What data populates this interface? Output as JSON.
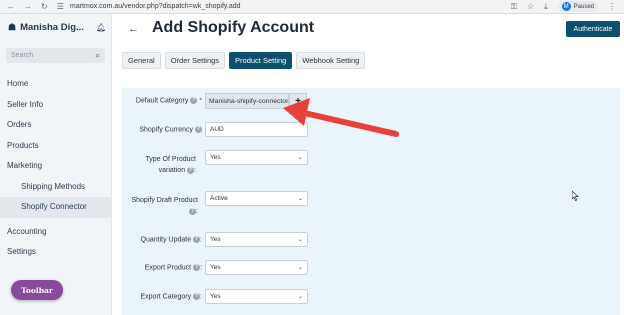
{
  "browser": {
    "url": "martmox.com.au/vendor.php?dispatch=wk_shopify.add",
    "profile_initial": "M",
    "profile_status": "Paused"
  },
  "sidebar": {
    "brand": "Manisha Dig...",
    "search_placeholder": "Search",
    "items": [
      {
        "label": "Home"
      },
      {
        "label": "Seller Info"
      },
      {
        "label": "Orders"
      },
      {
        "label": "Products"
      },
      {
        "label": "Marketing"
      },
      {
        "label": "Shipping Methods"
      },
      {
        "label": "Shopify Connector"
      },
      {
        "label": "Accounting"
      },
      {
        "label": "Settings"
      }
    ],
    "toolbar_label": "Toolbar"
  },
  "header": {
    "back_icon": "←",
    "title": "Add Shopify Account",
    "authenticate_label": "Authenticate"
  },
  "tabs": [
    {
      "label": "General"
    },
    {
      "label": "Order Settings"
    },
    {
      "label": "Product Setting"
    },
    {
      "label": "Webhook Setting"
    }
  ],
  "form": {
    "default_category": {
      "label": "Default Category",
      "required_mark": "*",
      "value": "Manisha-shipify-connector",
      "add_icon": "+"
    },
    "currency": {
      "label": "Shopify Currency",
      "value": "AUD"
    },
    "product_variation": {
      "label_line1": "Type Of Product",
      "label_line2": "variation",
      "value": "Yes"
    },
    "draft_product": {
      "label_line1": "Shopify Draft Product",
      "value": "Active"
    },
    "quantity_update": {
      "label": "Quantity Update",
      "value": "Yes"
    },
    "export_product": {
      "label": "Export Product",
      "value": "Yes"
    },
    "export_category": {
      "label": "Export Category",
      "value": "Yes"
    },
    "help_glyph": "?",
    "chevron": "⌄"
  },
  "colors": {
    "accent": "#0e4f6e",
    "annotation_arrow": "#e8413b",
    "panel_bg": "#eaf5fb"
  }
}
